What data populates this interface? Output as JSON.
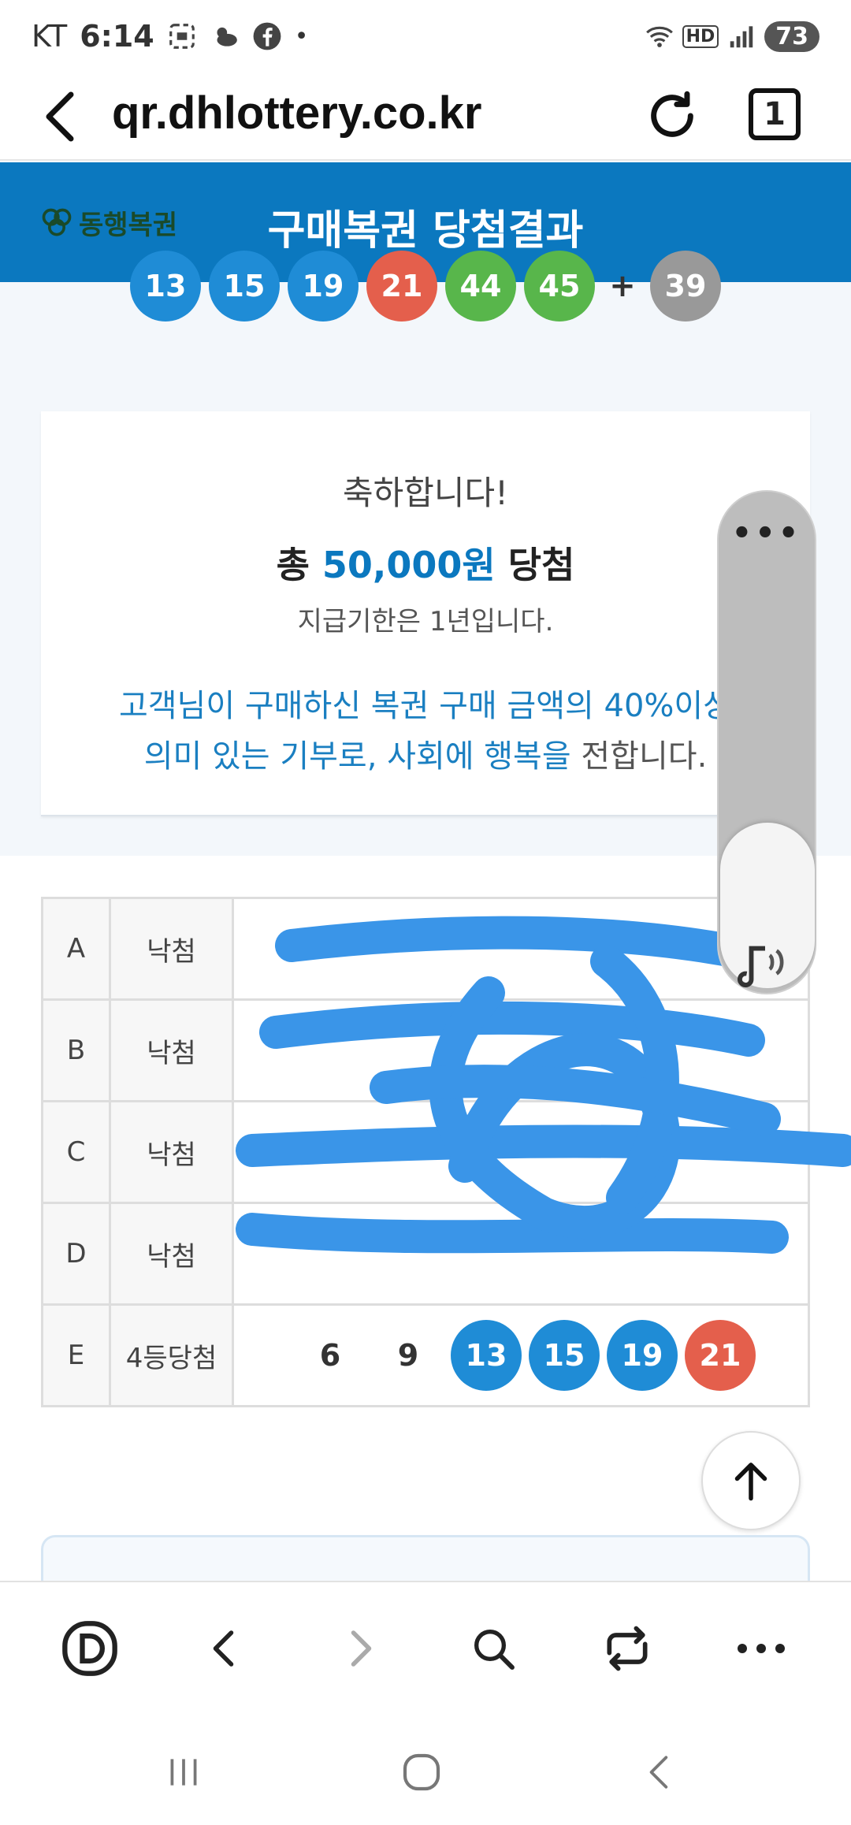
{
  "status_bar": {
    "carrier": "KT",
    "time": "6:14",
    "battery": "73"
  },
  "browser": {
    "url": "qr.dhlottery.co.kr",
    "tab_count": "1"
  },
  "site": {
    "logo_text": "동행복권",
    "title": "구매복권 당첨결과"
  },
  "winning_numbers": {
    "balls": [
      {
        "n": "13",
        "color": "#1f8cd6"
      },
      {
        "n": "15",
        "color": "#1f8cd6"
      },
      {
        "n": "19",
        "color": "#1f8cd6"
      },
      {
        "n": "21",
        "color": "#e45f4c"
      },
      {
        "n": "44",
        "color": "#58b64b"
      },
      {
        "n": "45",
        "color": "#58b64b"
      }
    ],
    "plus": "+",
    "bonus": "39"
  },
  "card": {
    "congrats": "축하합니다!",
    "prize_prefix": "총 ",
    "prize_amount": "50,000원",
    "prize_suffix": " 당첨",
    "deadline": "지급기한은 1년입니다.",
    "donate_line1": "고객님이 구매하신 복권 구매 금액의 40%이상",
    "donate_line2a": "의미 있는 기부로, 사회에 행복을",
    "donate_line2b": " 전합니다."
  },
  "results": [
    {
      "game": "A",
      "result": "낙첨",
      "numbers": []
    },
    {
      "game": "B",
      "result": "낙첨",
      "numbers": []
    },
    {
      "game": "C",
      "result": "낙첨",
      "numbers": []
    },
    {
      "game": "D",
      "result": "낙첨",
      "numbers": []
    },
    {
      "game": "E",
      "result": "4등당첨",
      "numbers": [
        {
          "n": "6",
          "hit": false
        },
        {
          "n": "9",
          "hit": false
        },
        {
          "n": "13",
          "hit": true,
          "color": "#1f8cd6"
        },
        {
          "n": "15",
          "hit": true,
          "color": "#1f8cd6"
        },
        {
          "n": "19",
          "hit": true,
          "color": "#1f8cd6"
        },
        {
          "n": "21",
          "hit": true,
          "color": "#e45f4c"
        }
      ]
    }
  ],
  "volume_widget": {
    "dots": "•••"
  },
  "colors": {
    "brand_blue": "#0b78bf",
    "ball_blue": "#1f8cd6",
    "ball_red": "#e45f4c",
    "ball_green": "#58b64b",
    "ball_gray": "#999999",
    "scribble": "#3a95e8"
  }
}
